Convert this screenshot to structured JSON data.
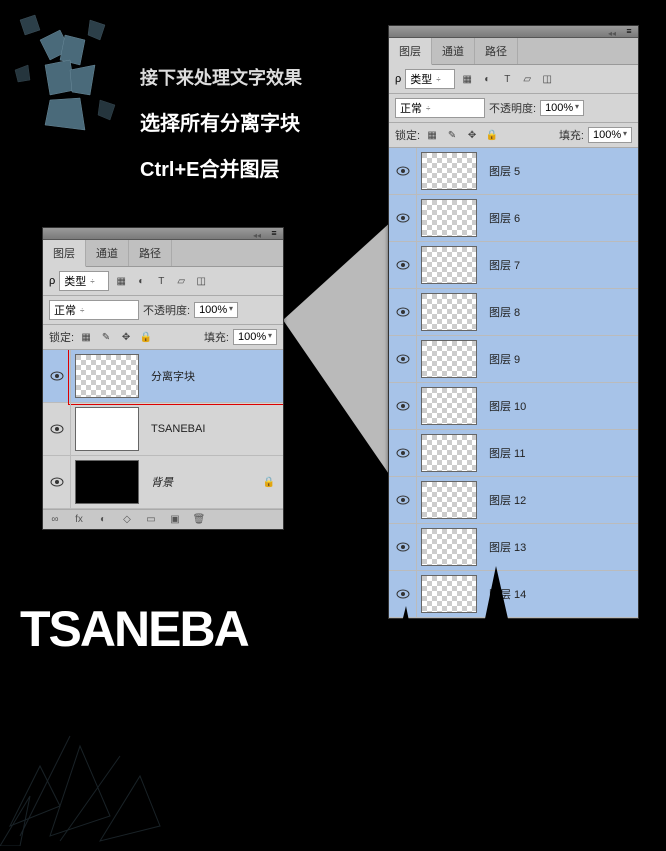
{
  "instructions": {
    "line1": "接下来处理文字效果",
    "line2": "选择所有分离字块",
    "line3": "Ctrl+E合并图层"
  },
  "logo": "TSANEBA",
  "panel_tabs": {
    "layers": "图层",
    "channels": "通道",
    "paths": "路径"
  },
  "toolbar": {
    "type_filter": "类型",
    "blend_mode": "正常",
    "opacity_label": "不透明度:",
    "opacity_value": "100%",
    "lock_label": "锁定:",
    "fill_label": "填充:",
    "fill_value": "100%"
  },
  "small_panel_layers": [
    {
      "name": "分离字块",
      "selected": true,
      "red": true,
      "thumb": "checker"
    },
    {
      "name": "TSANEBAI",
      "thumb": "white"
    },
    {
      "name": "背景",
      "locked": true,
      "italic": true,
      "thumb": "black"
    }
  ],
  "large_panel_layers": [
    {
      "name": "图层 5"
    },
    {
      "name": "图层 6"
    },
    {
      "name": "图层 7"
    },
    {
      "name": "图层 8"
    },
    {
      "name": "图层 9"
    },
    {
      "name": "图层 10"
    },
    {
      "name": "图层 11"
    },
    {
      "name": "图层 12"
    },
    {
      "name": "图层 13"
    },
    {
      "name": "图层 14"
    }
  ],
  "footer_icons": [
    "∞",
    "fx",
    "◐",
    "◇",
    "▭",
    "▣",
    "🗑"
  ]
}
